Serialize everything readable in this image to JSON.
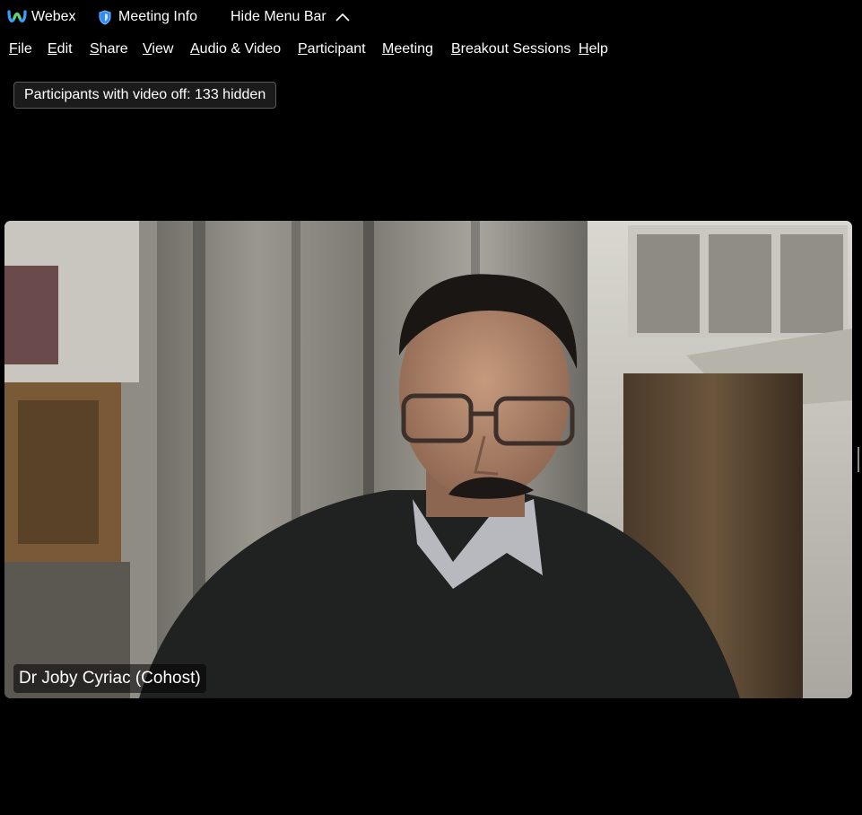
{
  "titlebar": {
    "app_name": "Webex",
    "meeting_info": "Meeting Info",
    "hide_menu_bar": "Hide Menu Bar"
  },
  "menubar": {
    "items": [
      {
        "first": "F",
        "rest": "ile"
      },
      {
        "first": "E",
        "rest": "dit"
      },
      {
        "first": "S",
        "rest": "hare"
      },
      {
        "first": "V",
        "rest": "iew"
      },
      {
        "first": "A",
        "rest": "udio & Video"
      },
      {
        "first": "P",
        "rest": "articipant"
      },
      {
        "first": "M",
        "rest": "eeting"
      },
      {
        "first": "B",
        "rest": "reakout Sessions"
      },
      {
        "first": "H",
        "rest": "elp"
      }
    ]
  },
  "hidden_participants": "Participants with video off: 133 hidden",
  "video": {
    "participant_name": "Dr Joby Cyriac (Cohost)"
  },
  "colors": {
    "background": "#000000",
    "webex_blue": "#2d8cff",
    "pill_border": "#5a5a5a"
  }
}
